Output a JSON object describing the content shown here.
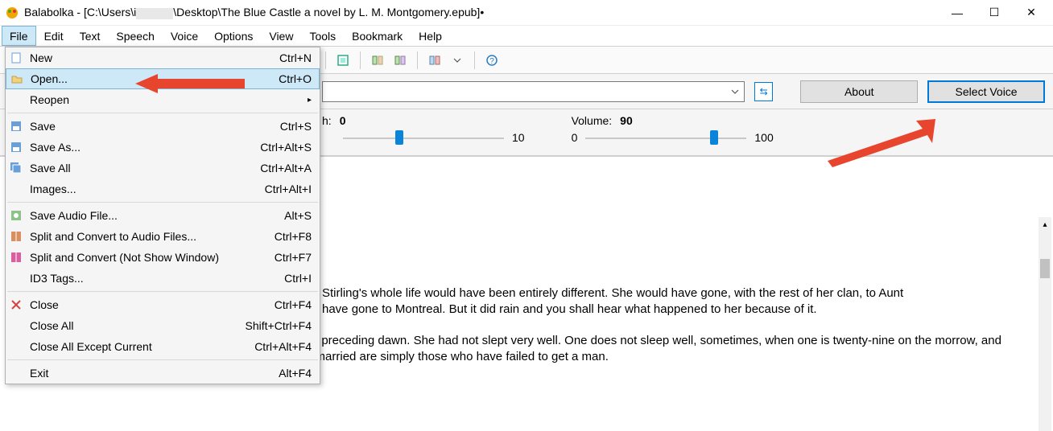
{
  "titlebar": {
    "app": "Balabolka",
    "path_prefix": " - [C:\\Users\\i",
    "path_suffix": "\\Desktop\\The Blue Castle a novel by L. M. Montgomery.epub]•"
  },
  "menubar": [
    "File",
    "Edit",
    "Text",
    "Speech",
    "Voice",
    "Options",
    "View",
    "Tools",
    "Bookmark",
    "Help"
  ],
  "file_menu": {
    "items": [
      {
        "label": "New",
        "shortcut": "Ctrl+N",
        "icon": "new"
      },
      {
        "label": "Open...",
        "shortcut": "Ctrl+O",
        "icon": "open",
        "hover": true
      },
      {
        "label": "Reopen",
        "shortcut": "",
        "sub": true
      },
      {
        "label": "Save",
        "shortcut": "Ctrl+S",
        "icon": "save"
      },
      {
        "label": "Save As...",
        "shortcut": "Ctrl+Alt+S",
        "icon": "saveas"
      },
      {
        "label": "Save All",
        "shortcut": "Ctrl+Alt+A",
        "icon": "saveall"
      },
      {
        "label": "Images...",
        "shortcut": "Ctrl+Alt+I"
      },
      {
        "label": "Save Audio File...",
        "shortcut": "Alt+S",
        "icon": "audio"
      },
      {
        "label": "Split and Convert to Audio Files...",
        "shortcut": "Ctrl+F8",
        "icon": "split"
      },
      {
        "label": "Split and Convert (Not Show Window)",
        "shortcut": "Ctrl+F7",
        "icon": "splitns"
      },
      {
        "label": "ID3 Tags...",
        "shortcut": "Ctrl+I"
      },
      {
        "label": "Close",
        "shortcut": "Ctrl+F4",
        "icon": "close"
      },
      {
        "label": "Close All",
        "shortcut": "Shift+Ctrl+F4"
      },
      {
        "label": "Close All Except Current",
        "shortcut": "Ctrl+Alt+F4"
      },
      {
        "label": "Exit",
        "shortcut": "Alt+F4"
      }
    ],
    "separators_after": [
      2,
      6,
      10,
      13
    ]
  },
  "voicebar": {
    "about": "About",
    "select_voice": "Select Voice"
  },
  "sliders": {
    "pitch": {
      "label": "h:",
      "value": "0",
      "min": "",
      "max": "10",
      "thumb_pct": 35
    },
    "volume": {
      "label": "Volume:",
      "value": "90",
      "min": "0",
      "max": "100",
      "thumb_pct": 80
    }
  },
  "text": {
    "p1": " Stirling's whole life would have been entirely different. She would have gone, with the rest of her clan, to Aunt",
    "p1b": " have gone to Montreal. But it did rain and you shall hear what happened to her because of it.",
    "p2": "Valancy wakened early, in the lifeless, hopeless hour just preceding dawn. She had not slept very well. One does not sleep well, sometimes, when one is twenty-nine on the morrow, and unmarried, in a community and connection where the unmarried are simply those who have failed to get a man."
  }
}
